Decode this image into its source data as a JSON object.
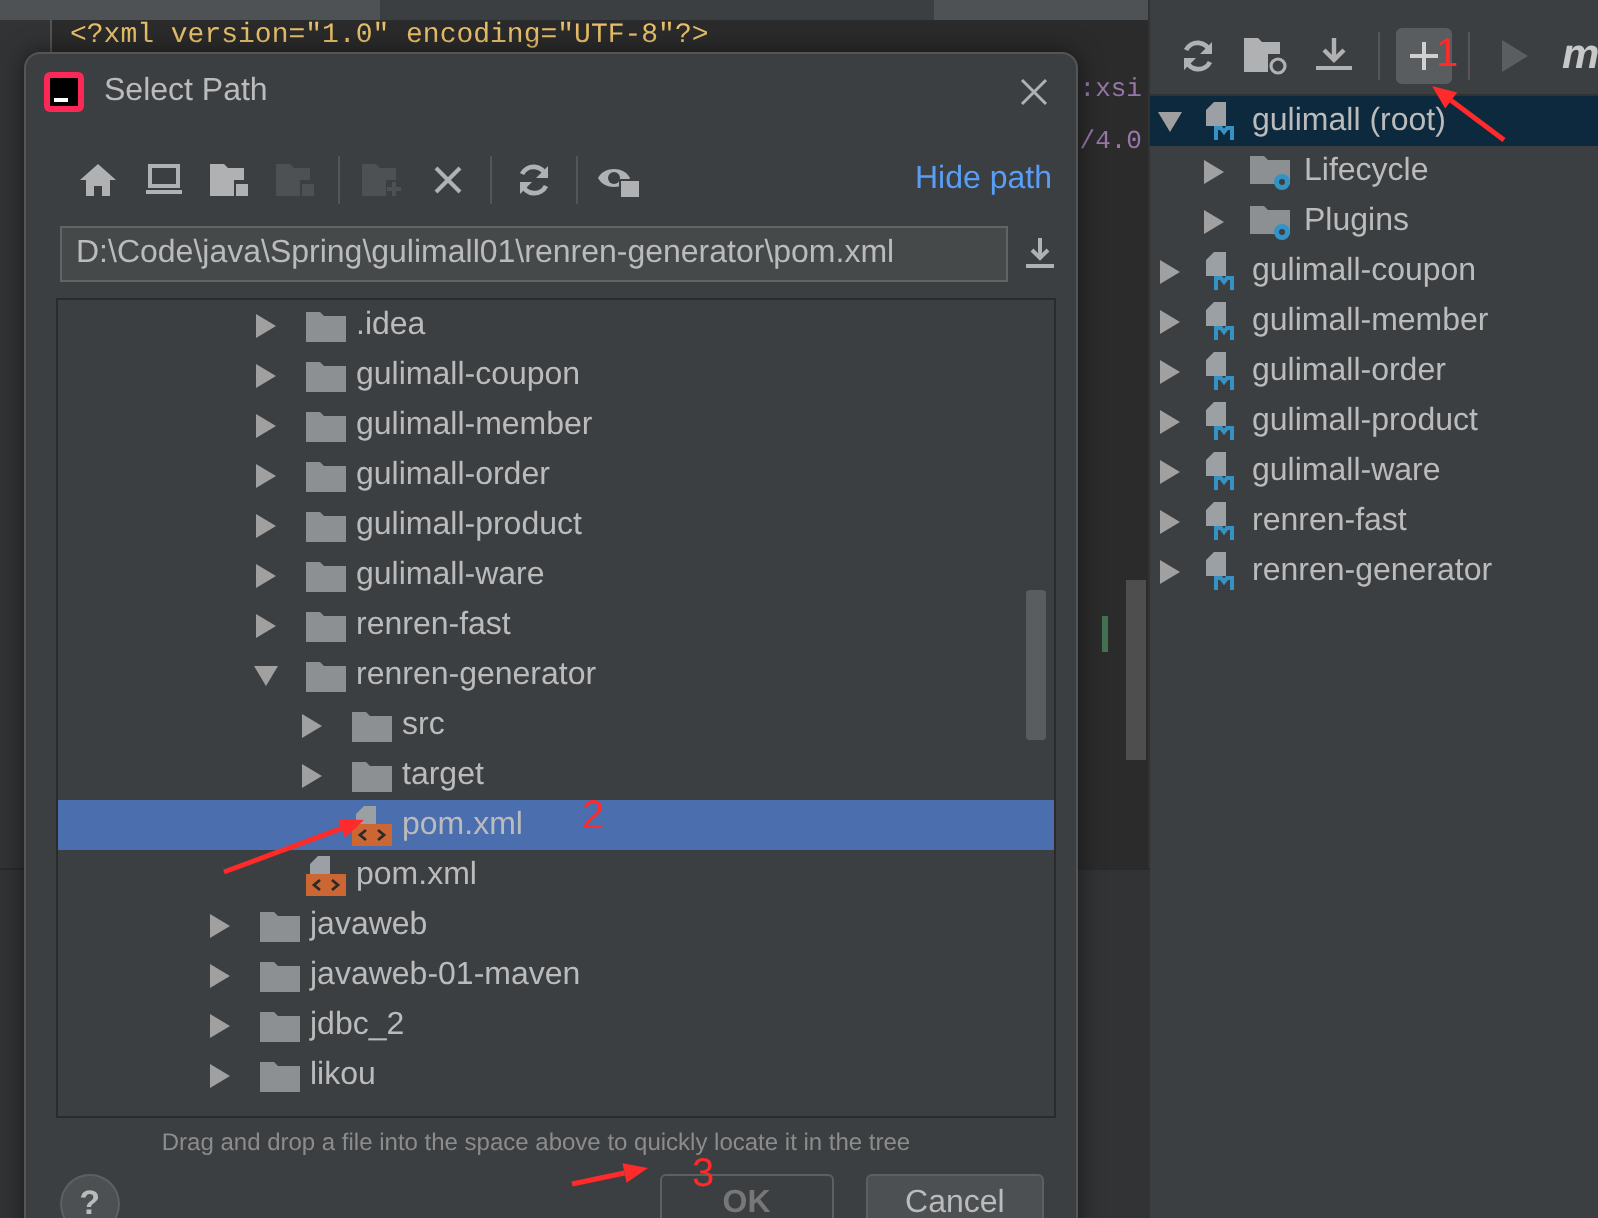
{
  "editor": {
    "lines": [
      {
        "kind": "code",
        "text": "<?xml version=\"1.0\" encoding=\"UTF-8\"?>"
      },
      {
        "kind": "tail",
        "text": ":xsi"
      },
      {
        "kind": "tail",
        "text": "/4.0"
      }
    ]
  },
  "maven": {
    "logo_glyph": "m",
    "tree": [
      {
        "label": "gulimall (root)",
        "selected": true,
        "expanded": true,
        "kind": "module",
        "children": [
          {
            "label": "Lifecycle",
            "selected": false,
            "expanded": false,
            "kind": "lifecycle"
          },
          {
            "label": "Plugins",
            "selected": false,
            "expanded": false,
            "kind": "lifecycle"
          }
        ]
      },
      {
        "label": "gulimall-coupon",
        "selected": false,
        "expanded": false,
        "kind": "module"
      },
      {
        "label": "gulimall-member",
        "selected": false,
        "expanded": false,
        "kind": "module"
      },
      {
        "label": "gulimall-order",
        "selected": false,
        "expanded": false,
        "kind": "module"
      },
      {
        "label": "gulimall-product",
        "selected": false,
        "expanded": false,
        "kind": "module"
      },
      {
        "label": "gulimall-ware",
        "selected": false,
        "expanded": false,
        "kind": "module"
      },
      {
        "label": "renren-fast",
        "selected": false,
        "expanded": false,
        "kind": "module"
      },
      {
        "label": "renren-generator",
        "selected": false,
        "expanded": false,
        "kind": "module"
      }
    ]
  },
  "dialog": {
    "title": "Select Path",
    "toolbar": [
      {
        "kind": "home",
        "disabled": false
      },
      {
        "kind": "desktop",
        "disabled": false
      },
      {
        "kind": "project",
        "disabled": false
      },
      {
        "kind": "module",
        "disabled": true
      },
      {
        "kind": "separator"
      },
      {
        "kind": "new-folder",
        "disabled": true
      },
      {
        "kind": "delete",
        "disabled": false
      },
      {
        "kind": "separator"
      },
      {
        "kind": "refresh",
        "disabled": false
      },
      {
        "kind": "separator"
      },
      {
        "kind": "hidden-files",
        "disabled": false
      }
    ],
    "hide_path_link": "Hide path",
    "path": "D:\\Code\\java\\Spring\\gulimall01\\renren-generator\\pom.xml",
    "tree": [
      {
        "children": [
          {
            "label": ".idea",
            "kind": "folder",
            "expanded": false,
            "selected": false
          },
          {
            "label": "gulimall-coupon",
            "kind": "folder",
            "expanded": false,
            "selected": false
          },
          {
            "label": "gulimall-member",
            "kind": "folder",
            "expanded": false,
            "selected": false
          },
          {
            "label": "gulimall-order",
            "kind": "folder",
            "expanded": false,
            "selected": false
          },
          {
            "label": "gulimall-product",
            "kind": "folder",
            "expanded": false,
            "selected": false
          },
          {
            "label": "gulimall-ware",
            "kind": "folder",
            "expanded": false,
            "selected": false
          },
          {
            "label": "renren-fast",
            "kind": "folder",
            "expanded": false,
            "selected": false
          },
          {
            "label": "renren-generator",
            "kind": "folder",
            "expanded": true,
            "selected": false,
            "children": [
              {
                "label": "src",
                "kind": "folder",
                "expanded": false,
                "selected": false
              },
              {
                "label": "target",
                "kind": "folder",
                "expanded": false,
                "selected": false
              },
              {
                "label": "pom.xml",
                "kind": "xml",
                "selected": true
              }
            ]
          },
          {
            "label": "pom.xml",
            "kind": "xml",
            "selected": false
          }
        ]
      },
      {
        "label": "javaweb",
        "kind": "folder",
        "expanded": false,
        "selected": false
      },
      {
        "label": "javaweb-01-maven",
        "kind": "folder",
        "expanded": false,
        "selected": false
      },
      {
        "label": "jdbc_2",
        "kind": "folder",
        "expanded": false,
        "selected": false
      },
      {
        "label": "likou",
        "kind": "folder",
        "expanded": false,
        "selected": false
      }
    ],
    "hint": "Drag and drop a file into the space above to quickly locate it in the tree",
    "help": "?",
    "buttons": [
      {
        "label": "OK",
        "disabled": true
      },
      {
        "label": "Cancel",
        "disabled": false
      }
    ]
  },
  "annotations": [
    {
      "label": "1"
    },
    {
      "label": "2"
    },
    {
      "label": "3"
    }
  ]
}
